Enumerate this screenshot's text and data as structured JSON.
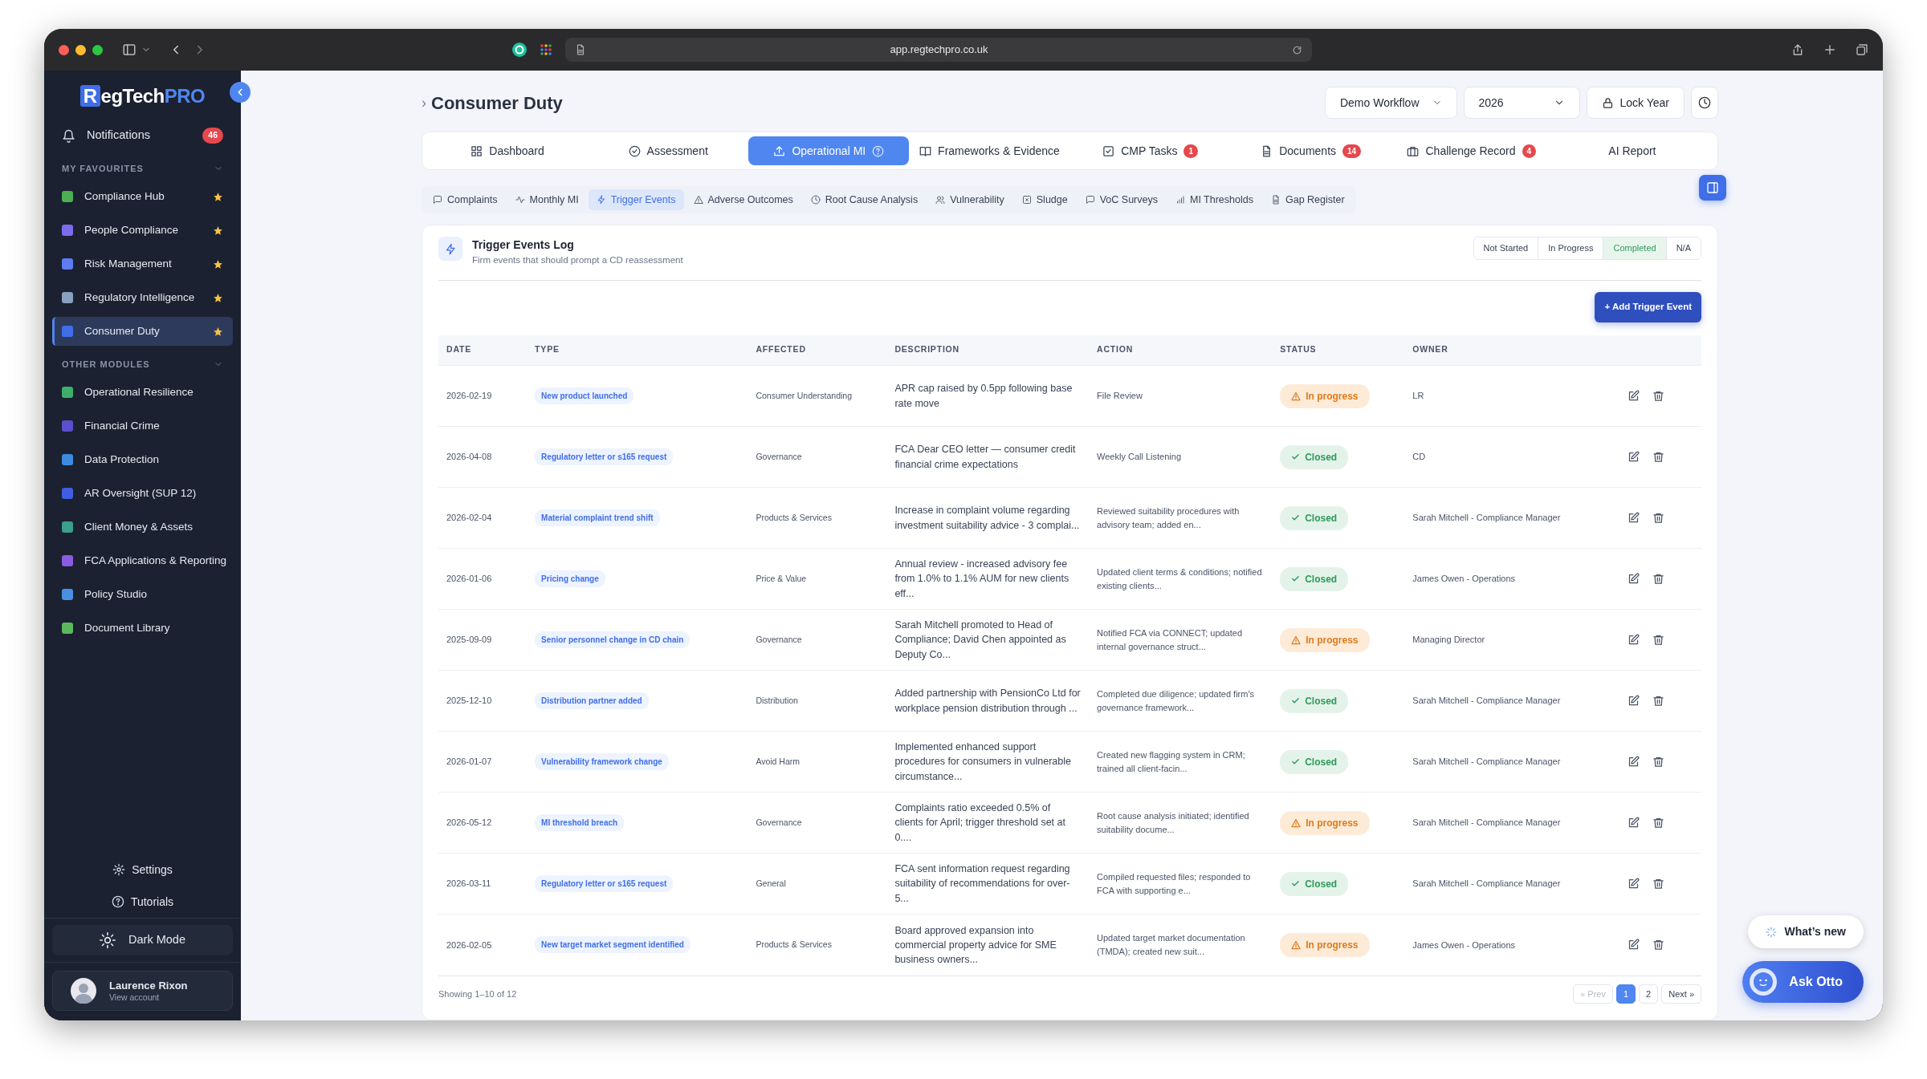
{
  "browser": {
    "url": "app.regtechpro.co.uk"
  },
  "sidebar": {
    "logo": {
      "mark": "R",
      "name": "egTech",
      "accent": "PRO"
    },
    "notifications": {
      "label": "Notifications",
      "count": "46"
    },
    "sections": [
      {
        "title": "MY FAVOURITES",
        "expanded": true,
        "items": [
          {
            "label": "Compliance Hub",
            "favourite": true,
            "selected": false,
            "color": "#4caf50"
          },
          {
            "label": "People Compliance",
            "favourite": true,
            "selected": false,
            "color": "#7c6cf0"
          },
          {
            "label": "Risk Management",
            "favourite": true,
            "selected": false,
            "color": "#5c7cf0"
          },
          {
            "label": "Regulatory Intelligence",
            "favourite": true,
            "selected": false,
            "color": "#8aa0c0"
          },
          {
            "label": "Consumer Duty",
            "favourite": true,
            "selected": true,
            "color": "#3f6ee8"
          }
        ]
      },
      {
        "title": "OTHER MODULES",
        "expanded": true,
        "items": [
          {
            "label": "Operational Resilience",
            "favourite": false,
            "selected": false,
            "color": "#3fae6a"
          },
          {
            "label": "Financial Crime",
            "favourite": false,
            "selected": false,
            "color": "#5a4fcf"
          },
          {
            "label": "Data Protection",
            "favourite": false,
            "selected": false,
            "color": "#3d8be0"
          },
          {
            "label": "AR Oversight (SUP 12)",
            "favourite": false,
            "selected": false,
            "color": "#3f5fe0"
          },
          {
            "label": "Client Money & Assets",
            "favourite": false,
            "selected": false,
            "color": "#3aa08c"
          },
          {
            "label": "FCA Applications & Reporting",
            "favourite": false,
            "selected": false,
            "color": "#8a5ce0"
          },
          {
            "label": "Policy Studio",
            "favourite": false,
            "selected": false,
            "color": "#4a90e2"
          },
          {
            "label": "Document Library",
            "favourite": false,
            "selected": false,
            "color": "#5cb85c"
          }
        ]
      }
    ],
    "footer_links": [
      "Settings",
      "Tutorials"
    ],
    "dark_mode": "Dark Mode",
    "user": {
      "name": "Laurence Rixon",
      "subtitle": "View account"
    }
  },
  "header": {
    "breadcrumb": "›",
    "title": "Consumer Duty",
    "workflow": "Demo Workflow",
    "year": "2026",
    "lock": "Lock Year"
  },
  "tabs": [
    {
      "label": "Dashboard",
      "selected": false
    },
    {
      "label": "Assessment",
      "selected": false
    },
    {
      "label": "Operational MI",
      "selected": true
    },
    {
      "label": "Frameworks & Evidence",
      "selected": false
    },
    {
      "label": "CMP Tasks",
      "badge": "1",
      "selected": false
    },
    {
      "label": "Documents",
      "badge": "14",
      "selected": false
    },
    {
      "label": "Challenge Record",
      "badge": "4",
      "selected": false
    },
    {
      "label": "AI Report",
      "selected": false
    }
  ],
  "subtabs": [
    {
      "label": "Complaints",
      "selected": false
    },
    {
      "label": "Monthly MI",
      "selected": false
    },
    {
      "label": "Trigger Events",
      "selected": true
    },
    {
      "label": "Adverse Outcomes",
      "selected": false
    },
    {
      "label": "Root Cause Analysis",
      "selected": false
    },
    {
      "label": "Vulnerability",
      "selected": false
    },
    {
      "label": "Sludge",
      "selected": false
    },
    {
      "label": "VoC Surveys",
      "selected": false
    },
    {
      "label": "MI Thresholds",
      "selected": false
    },
    {
      "label": "Gap Register",
      "selected": false
    }
  ],
  "card": {
    "title": "Trigger Events Log",
    "subtitle": "Firm events that should prompt a CD reassessment",
    "status_options": [
      {
        "label": "Not Started",
        "selected": false
      },
      {
        "label": "In Progress",
        "selected": false
      },
      {
        "label": "Completed",
        "selected": true
      },
      {
        "label": "N/A",
        "selected": false
      }
    ],
    "add_button": "+ Add Trigger Event",
    "table": {
      "columns": [
        "DATE",
        "TYPE",
        "AFFECTED",
        "DESCRIPTION",
        "ACTION",
        "STATUS",
        "OWNER"
      ],
      "rows": [
        {
          "date": "2026-02-19",
          "type": "New product launched",
          "affected": "Consumer Understanding",
          "description": "APR cap raised by 0.5pp following base rate move",
          "action": "File Review",
          "status": {
            "kind": "in_progress",
            "label": "In progress"
          },
          "owner": "LR"
        },
        {
          "date": "2026-04-08",
          "type": "Regulatory letter or s165 request",
          "affected": "Governance",
          "description": "FCA Dear CEO letter — consumer credit financial crime expectations",
          "action": "Weekly Call Listening",
          "status": {
            "kind": "closed",
            "label": "Closed"
          },
          "owner": "CD"
        },
        {
          "date": "2026-02-04",
          "type": "Material complaint trend shift",
          "affected": "Products & Services",
          "description": "Increase in complaint volume regarding investment suitability advice - 3 complai...",
          "action": "Reviewed suitability procedures with advisory team; added en...",
          "status": {
            "kind": "closed",
            "label": "Closed"
          },
          "owner": "Sarah Mitchell - Compliance Manager"
        },
        {
          "date": "2026-01-06",
          "type": "Pricing change",
          "affected": "Price & Value",
          "description": "Annual review - increased advisory fee from 1.0% to 1.1% AUM for new clients eff...",
          "action": "Updated client terms & conditions; notified existing clients...",
          "status": {
            "kind": "closed",
            "label": "Closed"
          },
          "owner": "James Owen - Operations"
        },
        {
          "date": "2025-09-09",
          "type": "Senior personnel change in CD chain",
          "affected": "Governance",
          "description": "Sarah Mitchell promoted to Head of Compliance; David Chen appointed as Deputy Co...",
          "action": "Notified FCA via CONNECT; updated internal governance struct...",
          "status": {
            "kind": "in_progress",
            "label": "In progress"
          },
          "owner": "Managing Director"
        },
        {
          "date": "2025-12-10",
          "type": "Distribution partner added",
          "affected": "Distribution",
          "description": "Added partnership with PensionCo Ltd for workplace pension distribution through ...",
          "action": "Completed due diligence; updated firm's governance framework...",
          "status": {
            "kind": "closed",
            "label": "Closed"
          },
          "owner": "Sarah Mitchell - Compliance Manager"
        },
        {
          "date": "2026-01-07",
          "type": "Vulnerability framework change",
          "affected": "Avoid Harm",
          "description": "Implemented enhanced support procedures for consumers in vulnerable circumstance...",
          "action": "Created new flagging system in CRM; trained all client-facin...",
          "status": {
            "kind": "closed",
            "label": "Closed"
          },
          "owner": "Sarah Mitchell - Compliance Manager"
        },
        {
          "date": "2026-05-12",
          "type": "MI threshold breach",
          "affected": "Governance",
          "description": "Complaints ratio exceeded 0.5% of clients for April; trigger threshold set at 0....",
          "action": "Root cause analysis initiated; identified suitability docume...",
          "status": {
            "kind": "in_progress",
            "label": "In progress"
          },
          "owner": "Sarah Mitchell - Compliance Manager"
        },
        {
          "date": "2026-03-11",
          "type": "Regulatory letter or s165 request",
          "affected": "General",
          "description": "FCA sent information request regarding suitability of recommendations for over-5...",
          "action": "Compiled requested files; responded to FCA with supporting e...",
          "status": {
            "kind": "closed",
            "label": "Closed"
          },
          "owner": "Sarah Mitchell - Compliance Manager"
        },
        {
          "date": "2026-02-05",
          "type": "New target market segment identified",
          "affected": "Products & Services",
          "description": "Board approved expansion into commercial property advice for SME business owners...",
          "action": "Updated target market documentation (TMDA); created new suit...",
          "status": {
            "kind": "in_progress",
            "label": "In progress"
          },
          "owner": "James Owen - Operations"
        }
      ]
    },
    "showing": "Showing 1–10 of 12",
    "pagination": {
      "prev": {
        "label": "« Prev",
        "disabled": true
      },
      "pages": [
        {
          "label": "1",
          "selected": true
        },
        {
          "label": "2",
          "selected": false
        }
      ],
      "next": {
        "label": "Next »",
        "disabled": false
      }
    }
  },
  "whats_new": "What’s new",
  "ask_otto": "Ask Otto"
}
